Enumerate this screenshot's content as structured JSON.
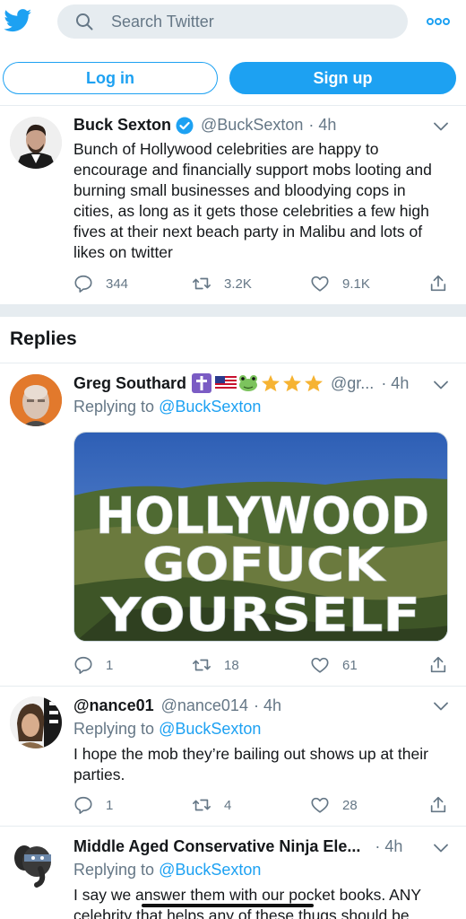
{
  "header": {
    "search_placeholder": "Search Twitter",
    "login_label": "Log in",
    "signup_label": "Sign up",
    "brand_color": "#1da1f2"
  },
  "main_tweet": {
    "name": "Buck Sexton",
    "verified": true,
    "handle": "@BuckSexton",
    "time": "· 4h",
    "text": "Bunch of Hollywood celebrities are happy to encourage and financially support mobs looting and burning small businesses and bloodying cops in cities, as long as it gets those celebrities a few high fives at their next beach party in Malibu and lots of likes on twitter",
    "replies": "344",
    "retweets": "3.2K",
    "likes": "9.1K"
  },
  "replies_section": {
    "title": "Replies",
    "items": [
      {
        "name": "Greg Southard",
        "emoji_icons": [
          "latin-cross-icon",
          "us-flag-icon",
          "frog-icon",
          "star-icon",
          "star-icon",
          "star-icon"
        ],
        "handle": "@gr...",
        "time": "· 4h",
        "replying_prefix": "Replying to",
        "replying_to": "@BuckSexton",
        "image_text": [
          "HOLLYWOOD",
          "GOFUCK",
          "YOURSELF"
        ],
        "replies": "1",
        "retweets": "18",
        "likes": "61"
      },
      {
        "name": "@nance01",
        "handle": "@nance014",
        "time": "· 4h",
        "replying_prefix": "Replying to",
        "replying_to": "@BuckSexton",
        "text": "I hope the mob they’re bailing out shows up at their parties.",
        "replies": "1",
        "retweets": "4",
        "likes": "28"
      },
      {
        "name": "Middle Aged Conservative Ninja Ele...",
        "time": "· 4h",
        "replying_prefix": "Replying to",
        "replying_to": "@BuckSexton",
        "text_line1": "I say we answer them with our pocket books. ANY",
        "text_line2": "celebrity that helps any of these thugs should be"
      }
    ]
  }
}
